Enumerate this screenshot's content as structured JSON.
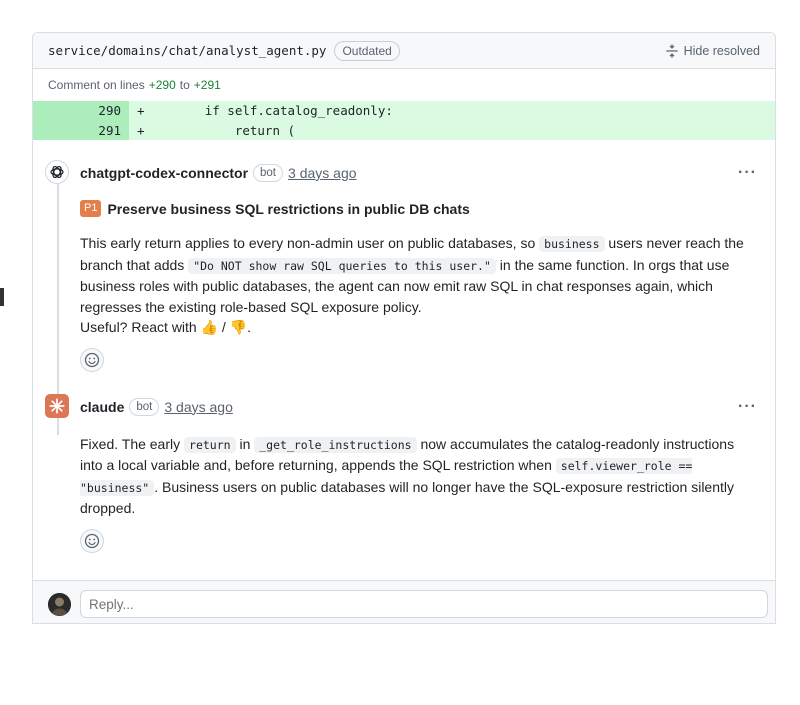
{
  "file": {
    "path": "service/domains/chat/analyst_agent.py",
    "badge": "Outdated",
    "hide_resolved": "Hide resolved"
  },
  "comment_range": {
    "prefix": "Comment on lines",
    "from": "+290",
    "to_word": "to",
    "to": "+291"
  },
  "code_lines": [
    {
      "num": "290",
      "text": "+        if self.catalog_readonly:"
    },
    {
      "num": "291",
      "text": "+            return ("
    }
  ],
  "comments": [
    {
      "author": "chatgpt-codex-connector",
      "bot": "bot",
      "time": "3 days ago",
      "more": "···",
      "priority": "P1",
      "title": "Preserve business SQL restrictions in public DB chats",
      "body": {
        "t1": "This early return applies to every non-admin user on public databases, so ",
        "c1": "business",
        "t2": " users never reach the branch that adds ",
        "c2": "\"Do NOT show raw SQL queries to this user.\"",
        "t3": " in the same function. In orgs that use business roles with public databases, the agent can now emit raw SQL in chat responses again, which regresses the existing role-based SQL exposure policy."
      },
      "useful": "Useful? React with 👍 / 👎."
    },
    {
      "author": "claude",
      "bot": "bot",
      "time": "3 days ago",
      "more": "···",
      "body": {
        "t1": "Fixed. The early ",
        "c1": "return",
        "t2": " in ",
        "c2": "_get_role_instructions",
        "t3": " now accumulates the catalog-readonly instructions into a local variable and, before returning, appends the SQL restriction when ",
        "c3": "self.viewer_role == \"business\"",
        "t4": ". Business users on public databases will no longer have the SQL-exposure restriction silently dropped."
      }
    }
  ],
  "reply": {
    "placeholder": "Reply..."
  },
  "colors": {
    "added_line_bg": "#dafbe1",
    "added_num_bg": "#aceebb",
    "priority_badge": "#e37f4a",
    "claude_avatar": "#d97757"
  }
}
